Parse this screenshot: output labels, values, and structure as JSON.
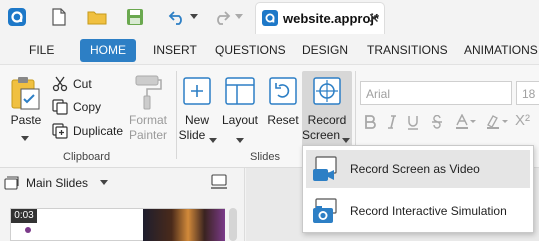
{
  "app": {
    "document_tab": {
      "title": "website.approj*",
      "close": "✕"
    }
  },
  "ribbon_tabs": [
    "FILE",
    "HOME",
    "INSERT",
    "QUESTIONS",
    "DESIGN",
    "TRANSITIONS",
    "ANIMATIONS"
  ],
  "active_tab": "HOME",
  "clipboard": {
    "paste": "Paste",
    "cut": "Cut",
    "copy": "Copy",
    "duplicate": "Duplicate",
    "format_painter_line1": "Format",
    "format_painter_line2": "Painter",
    "group_label": "Clipboard"
  },
  "slides": {
    "new_slide_line1": "New",
    "new_slide_line2": "Slide",
    "layout": "Layout",
    "reset": "Reset",
    "record_line1": "Record",
    "record_line2": "Screen",
    "group_label": "Slides"
  },
  "font": {
    "family": "Arial",
    "size": "18"
  },
  "slide_panel": {
    "selector": "Main Slides",
    "thumb_time": "0:03"
  },
  "record_menu": {
    "items": [
      {
        "label": "Record Screen as Video",
        "icon": "video-camera-icon"
      },
      {
        "label": "Record Interactive Simulation",
        "icon": "camera-icon"
      }
    ]
  },
  "colors": {
    "accent": "#2d7fc5",
    "brand_blue": "#1d78c8",
    "folder_yellow": "#f0c040",
    "save_green": "#6aa84f"
  }
}
